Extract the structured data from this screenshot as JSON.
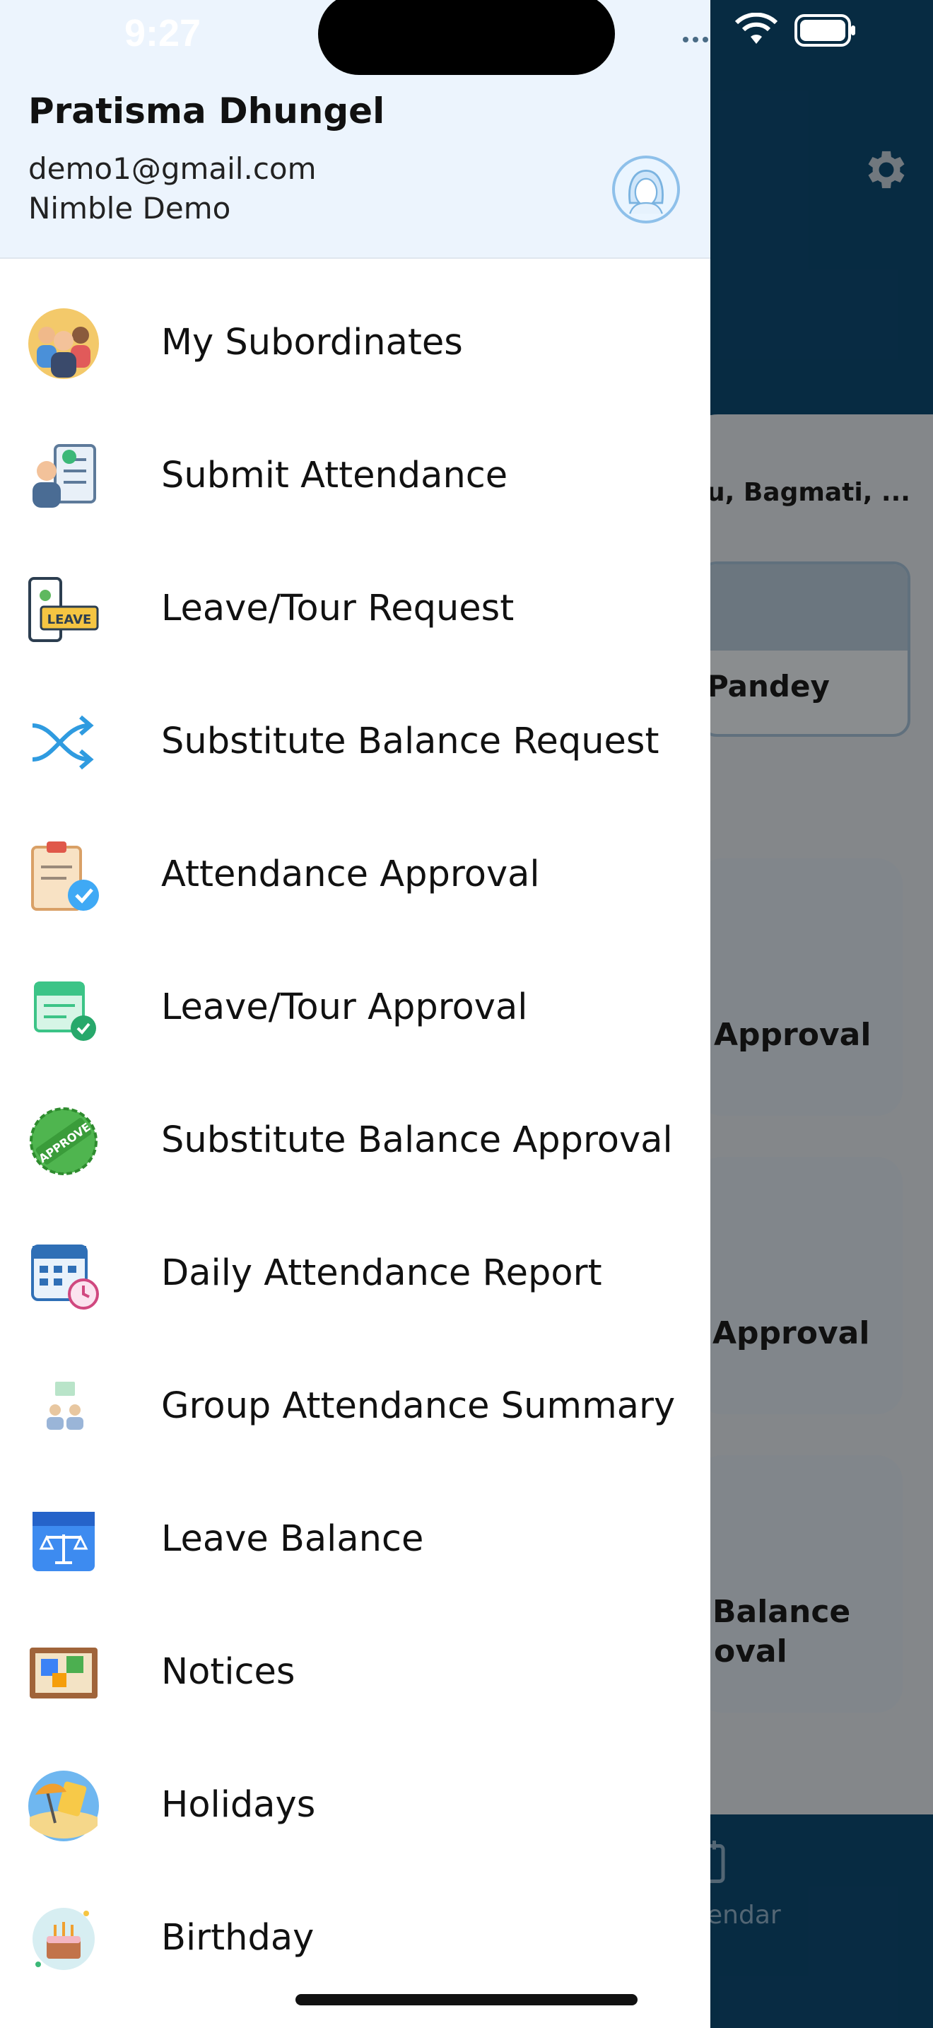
{
  "status_bar": {
    "time": "9:27"
  },
  "user": {
    "name": "Pratisma Dhungel",
    "email": "demo1@gmail.com",
    "organization": "Nimble Demo"
  },
  "menu": [
    {
      "label": "My Subordinates",
      "icon": "subordinates-icon"
    },
    {
      "label": "Submit Attendance",
      "icon": "submit-attendance-icon"
    },
    {
      "label": "Leave/Tour Request",
      "icon": "leave-request-icon"
    },
    {
      "label": "Substitute Balance Request",
      "icon": "shuffle-icon"
    },
    {
      "label": "Attendance Approval",
      "icon": "clipboard-check-icon"
    },
    {
      "label": "Leave/Tour Approval",
      "icon": "calendar-check-icon"
    },
    {
      "label": "Substitute Balance Approval",
      "icon": "approve-badge-icon"
    },
    {
      "label": "Daily Attendance Report",
      "icon": "calendar-clock-icon"
    },
    {
      "label": "Group Attendance Summary",
      "icon": "group-summary-icon"
    },
    {
      "label": "Leave Balance",
      "icon": "balance-calendar-icon"
    },
    {
      "label": "Notices",
      "icon": "notice-board-icon"
    },
    {
      "label": "Holidays",
      "icon": "beach-icon"
    },
    {
      "label": "Birthday",
      "icon": "birthday-cake-icon"
    }
  ],
  "background": {
    "location": "u, Bagmati, ...",
    "name_fragment": "Pandey",
    "card1_text": "Approval",
    "card2_text": "Approval",
    "card3_line1": "Balance",
    "card3_line2": "oval",
    "nav_fragment": "endar"
  },
  "colors": {
    "header_bg": "#ecf4fd",
    "app_primary": "#0d4a73",
    "text": "#111111"
  }
}
